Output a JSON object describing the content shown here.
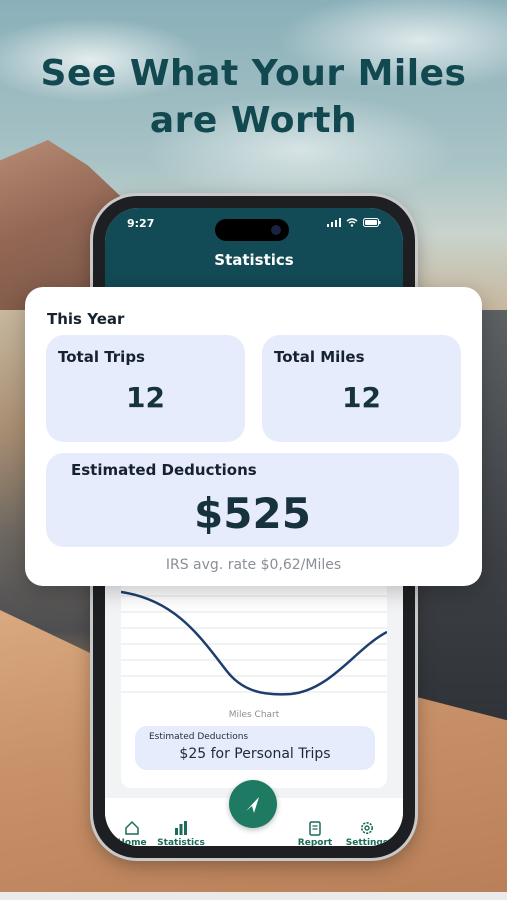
{
  "headline": {
    "line1": "See What Your Miles",
    "line2": "are Worth"
  },
  "status_bar": {
    "time": "9:27",
    "icons": "signal wifi battery"
  },
  "screen": {
    "title": "Statistics"
  },
  "overlay": {
    "section_title": "This Year",
    "total_trips": {
      "label": "Total Trips",
      "value": "12"
    },
    "total_miles": {
      "label": "Total Miles",
      "value": "12"
    },
    "estimated": {
      "label": "Estimated Deductions",
      "value": "$525"
    },
    "irs_note": "IRS avg. rate $0,62/Miles"
  },
  "chart": {
    "caption": "Miles Chart",
    "line_color": "#1e3e6e"
  },
  "deduction_box": {
    "label": "Estimated Deductions",
    "value": "$25 for Personal Trips"
  },
  "tabs": [
    {
      "label": "Home",
      "icon": "home-icon"
    },
    {
      "label": "Statistics",
      "icon": "bar-chart-icon"
    },
    {
      "label": "Report",
      "icon": "report-icon"
    },
    {
      "label": "Settings",
      "icon": "gear-icon"
    }
  ],
  "fab": {
    "icon": "navigation-arrow-icon"
  },
  "colors": {
    "brand": "#124a55",
    "accent": "#1f7a63",
    "card": "#e6ecfb",
    "headline": "#12484f"
  }
}
